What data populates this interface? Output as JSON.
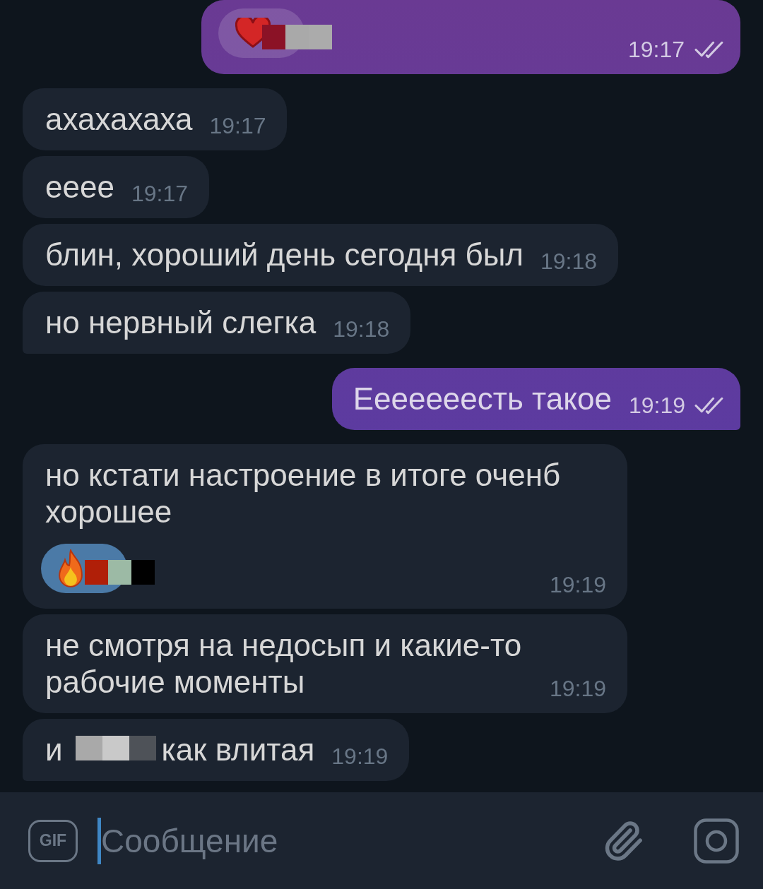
{
  "messages": [
    {
      "kind": "outgoing",
      "tail": false,
      "reaction": {
        "kind": "heart",
        "patches": [
          {
            "color": "#8b1226"
          },
          {
            "color": "#a9a9a9"
          },
          {
            "color": "#ababab"
          }
        ]
      },
      "time": "19:17",
      "read": true
    },
    {
      "kind": "incoming",
      "tail": false,
      "parts": [
        {
          "kind": "text",
          "text": "ахахахаха"
        }
      ],
      "time": "19:17"
    },
    {
      "kind": "incoming",
      "tail": false,
      "parts": [
        {
          "kind": "text",
          "text": "ееее"
        }
      ],
      "time": "19:17"
    },
    {
      "kind": "incoming",
      "tail": false,
      "parts": [
        {
          "kind": "text",
          "text": "блин, хороший день сегодня был"
        }
      ],
      "time": "19:18"
    },
    {
      "kind": "incoming",
      "tail": true,
      "parts": [
        {
          "kind": "text",
          "text": "но нервный слегка"
        }
      ],
      "time": "19:18"
    },
    {
      "kind": "outgoing",
      "tail": true,
      "parts": [
        {
          "kind": "text",
          "text": "Ееееееесть такое"
        }
      ],
      "time": "19:19",
      "read": true
    },
    {
      "kind": "incoming",
      "tail": false,
      "parts": [
        {
          "kind": "text",
          "text": "но кстати настроение в итоге оченб хорошее"
        }
      ],
      "reaction": {
        "kind": "fire",
        "patches": [
          {
            "color": "#b01f08"
          },
          {
            "color": "#9cbaa5"
          },
          {
            "color": "#000000"
          }
        ]
      },
      "time": "19:19"
    },
    {
      "kind": "incoming",
      "tail": false,
      "parts": [
        {
          "kind": "text",
          "text": "не смотря на недосып и какие-то рабочие моменты"
        }
      ],
      "time": "19:19"
    },
    {
      "kind": "incoming",
      "tail": true,
      "parts": [
        {
          "kind": "text",
          "text": "и"
        },
        {
          "kind": "redaction",
          "patches": [
            {
              "color": "#a9a9a9"
            },
            {
              "color": "#c9c9c9"
            },
            {
              "color": "#4e5258"
            }
          ]
        },
        {
          "kind": "text",
          "text": "как влитая"
        }
      ],
      "time": "19:19"
    }
  ],
  "composer": {
    "gif_label": "GIF",
    "placeholder": "Сообщение"
  }
}
